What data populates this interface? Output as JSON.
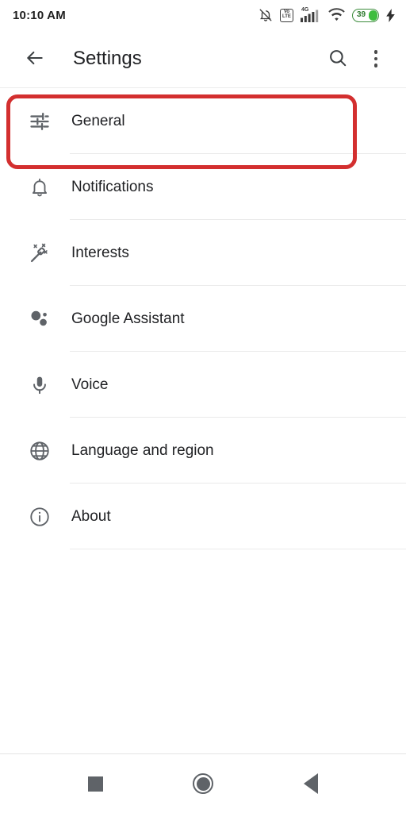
{
  "status_bar": {
    "time": "10:10 AM",
    "icons": [
      {
        "name": "notifications-off-icon"
      },
      {
        "name": "volte-icon",
        "line1": "Vo",
        "line2": "LTE"
      },
      {
        "name": "mobile-signal-icon",
        "network": "4G"
      },
      {
        "name": "wifi-icon"
      },
      {
        "name": "battery-icon",
        "level": "39"
      },
      {
        "name": "charging-bolt-icon"
      }
    ],
    "battery_level": "39",
    "network_label": "4G",
    "volte_line1": "Vo",
    "volte_line2": "LTE",
    "battery_color": "#3ebd3e"
  },
  "toolbar": {
    "back_label": "Back",
    "title": "Settings",
    "search_label": "Search",
    "overflow_label": "More options"
  },
  "highlight": {
    "color": "#d32f2f",
    "target": "General"
  },
  "settings_list": [
    {
      "label": "General",
      "icon": "tune-icon"
    },
    {
      "label": "Notifications",
      "icon": "bell-icon"
    },
    {
      "label": "Interests",
      "icon": "magic-wand-icon"
    },
    {
      "label": "Google Assistant",
      "icon": "google-assistant-icon"
    },
    {
      "label": "Voice",
      "icon": "microphone-icon"
    },
    {
      "label": "Language and region",
      "icon": "globe-icon"
    },
    {
      "label": "About",
      "icon": "info-circle-icon"
    }
  ],
  "nav_bar": {
    "recents_label": "Recents",
    "home_label": "Home",
    "back_label": "Back"
  }
}
